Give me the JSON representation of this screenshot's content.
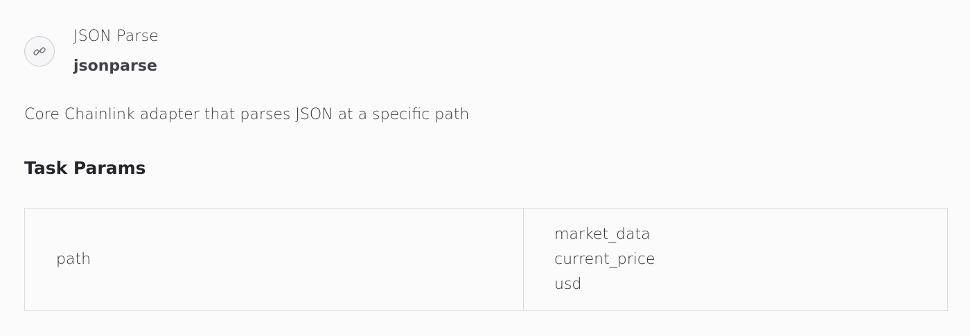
{
  "adapter": {
    "name": "JSON Parse",
    "slug": "jsonparse",
    "icon": "link-icon",
    "description": "Core Chainlink adapter that parses JSON at a specific path"
  },
  "task_params": {
    "title": "Task Params",
    "rows": [
      {
        "key": "path",
        "values": [
          "market_data",
          "current_price",
          "usd"
        ]
      }
    ]
  }
}
